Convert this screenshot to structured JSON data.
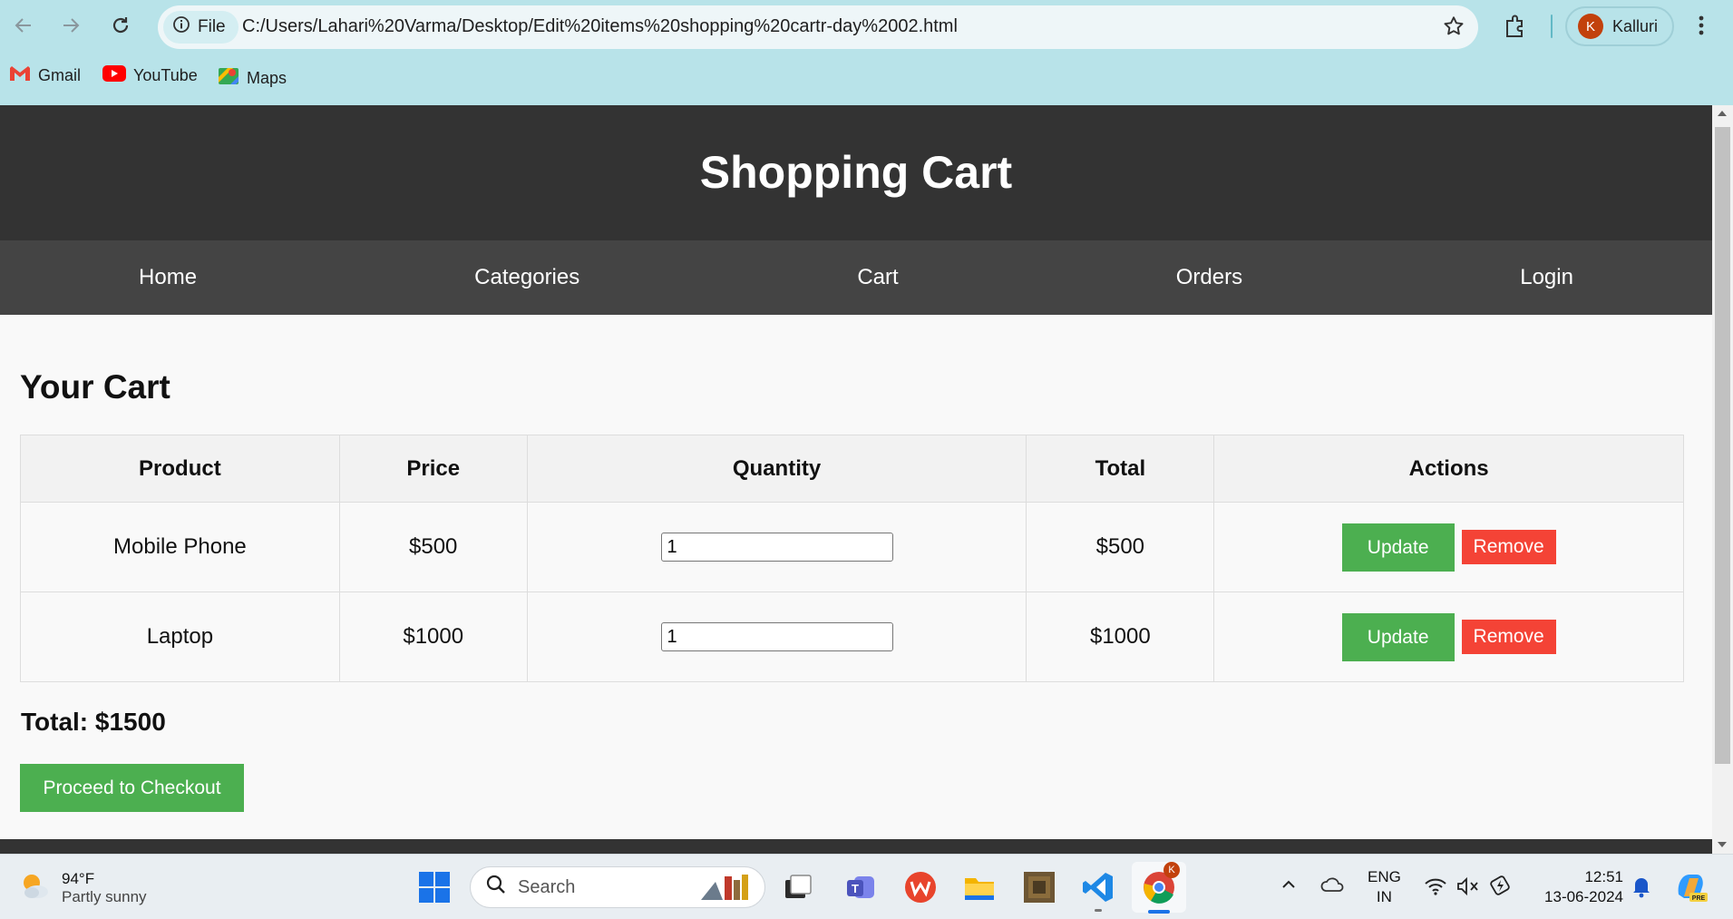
{
  "browser": {
    "site_chip": "File",
    "url": "C:/Users/Lahari%20Varma/Desktop/Edit%20items%20shopping%20cartr-day%2002.html",
    "profile_initial": "K",
    "profile_name": "Kalluri",
    "bookmarks": [
      {
        "label": "Gmail",
        "icon": "gmail-icon"
      },
      {
        "label": "YouTube",
        "icon": "youtube-icon"
      },
      {
        "label": "Maps",
        "icon": "maps-icon"
      }
    ]
  },
  "site": {
    "title": "Shopping Cart",
    "nav": [
      "Home",
      "Categories",
      "Cart",
      "Orders",
      "Login"
    ]
  },
  "cart": {
    "heading": "Your Cart",
    "columns": [
      "Product",
      "Price",
      "Quantity",
      "Total",
      "Actions"
    ],
    "rows": [
      {
        "product": "Mobile Phone",
        "price": "$500",
        "quantity": "1",
        "total": "$500"
      },
      {
        "product": "Laptop",
        "price": "$1000",
        "quantity": "1",
        "total": "$1000"
      }
    ],
    "update_label": "Update",
    "remove_label": "Remove",
    "grand_total": "Total: $1500",
    "checkout_label": "Proceed to Checkout"
  },
  "taskbar": {
    "weather_temp": "94°F",
    "weather_desc": "Partly sunny",
    "search_placeholder": "Search",
    "lang_top": "ENG",
    "lang_bottom": "IN",
    "time": "12:51",
    "date": "13-06-2024"
  },
  "colors": {
    "header_bg": "#333333",
    "nav_bg": "#444444",
    "update_green": "#4caf50",
    "remove_red": "#f44336",
    "browser_frame": "#b8e3e9"
  }
}
